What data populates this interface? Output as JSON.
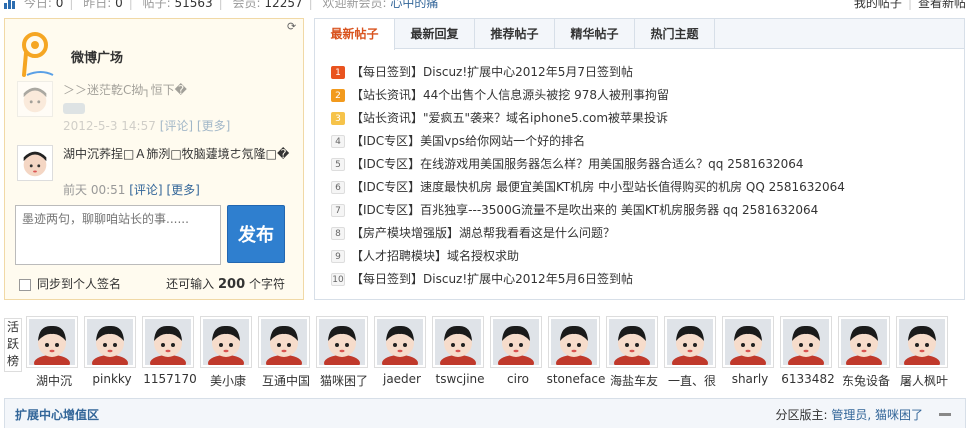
{
  "topbar": {
    "today_label": "今日:",
    "today_value": "0",
    "yesterday_label": "昨日:",
    "yesterday_value": "0",
    "posts_label": "帖子:",
    "posts_value": "51563",
    "members_label": "会员:",
    "members_value": "12257",
    "welcome_label": "欢迎新会员:",
    "newest_member": "心中的痛",
    "my_posts": "我的帖子",
    "view_new": "查看新帖"
  },
  "weibo": {
    "title": "微博广场",
    "posts": [
      {
        "text": "＞＞迷茫亁C拗┐恒下�",
        "time": "2012-5-3 14:57",
        "comment": "[评论]",
        "more": "[更多]"
      },
      {
        "text": "湖中沉荞挰□Ａ斾洌□牧脑蘧境ㄜ氖隆□�",
        "time": "前天 00:51",
        "comment": "[评论]",
        "more": "[更多]"
      }
    ],
    "composer_placeholder": "墨迹两句，聊聊咱站长的事......",
    "publish": "发布",
    "sync_label": "同步到个人签名",
    "remain_prefix": "还可输入",
    "remain_count": "200",
    "remain_suffix": "个字符"
  },
  "topics": {
    "tabs": [
      "最新帖子",
      "最新回复",
      "推荐帖子",
      "精华帖子",
      "热门主题"
    ],
    "active_tab": "最新帖子",
    "items": [
      {
        "num": "1",
        "cat": "【每日签到】",
        "title": "Discuz!扩展中心2012年5月7日签到帖"
      },
      {
        "num": "2",
        "cat": "【站长资讯】",
        "title": "44个出售个人信息源头被挖 978人被刑事拘留"
      },
      {
        "num": "3",
        "cat": "【站长资讯】",
        "title": "\"爱疯五\"袭来？域名iphone5.com被苹果投诉"
      },
      {
        "num": "4",
        "cat": "【IDC专区】",
        "title": "美国vps给你网站一个好的排名"
      },
      {
        "num": "5",
        "cat": "【IDC专区】",
        "title": "在线游戏用美国服务器怎么样？用美国服务器合适么？qq 2581632064"
      },
      {
        "num": "6",
        "cat": "【IDC专区】",
        "title": "速度最快机房 最便宜美国KT机房 中小型站长值得购买的机房 QQ 2581632064"
      },
      {
        "num": "7",
        "cat": "【IDC专区】",
        "title": "百兆独享---3500G流量不是吹出来的 美国KT机房服务器 qq 2581632064"
      },
      {
        "num": "8",
        "cat": "【房产模块增强版】",
        "title": "湖总帮我看看这是什么问题？"
      },
      {
        "num": "9",
        "cat": "【人才招聘模块】",
        "title": "域名授权求助"
      },
      {
        "num": "10",
        "cat": "【每日签到】",
        "title": "Discuz!扩展中心2012年5月6日签到帖"
      }
    ]
  },
  "active_members": {
    "label": "活跃榜",
    "members": [
      "湖中沉",
      "pinkky",
      "1157170",
      "美小康",
      "互通中国",
      "猫咪困了",
      "jaeder",
      "tswcjine",
      "ciro",
      "stoneface",
      "海盐车友",
      "一直、很",
      "sharly",
      "6133482",
      "东兔设备",
      "屠人枫叶"
    ]
  },
  "section": {
    "title": "扩展中心增值区",
    "moderators_label": "分区版主:",
    "moderators": "管理员, 猫咪困了"
  },
  "icons": {
    "stats": "bar-chart-icon",
    "refresh": "refresh-icon",
    "collapse": "minus-icon"
  }
}
